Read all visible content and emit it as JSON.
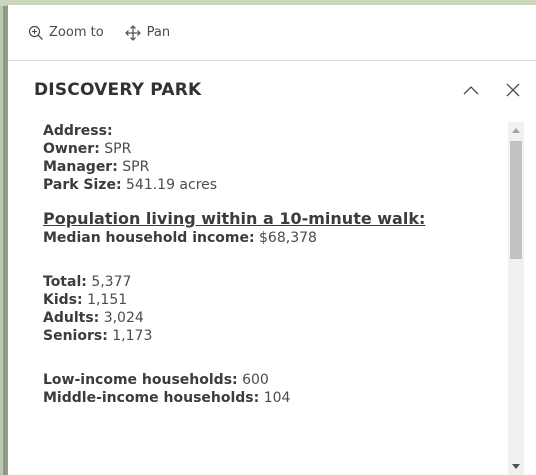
{
  "toolbar": {
    "zoom_label": "Zoom to",
    "pan_label": "Pan"
  },
  "popup": {
    "title": "DISCOVERY PARK"
  },
  "details": {
    "address_label": "Address:",
    "address_value": "",
    "owner_label": "Owner:",
    "owner_value": "SPR",
    "manager_label": "Manager:",
    "manager_value": "SPR",
    "size_label": "Park Size:",
    "size_value": "541.19 acres",
    "population_heading": "Population living within a 10-minute walk:",
    "income_label": "Median household income:",
    "income_value": "$68,378",
    "total_label": "Total:",
    "total_value": "5,377",
    "kids_label": "Kids:",
    "kids_value": "1,151",
    "adults_label": "Adults:",
    "adults_value": "3,024",
    "seniors_label": "Seniors:",
    "seniors_value": "1,173",
    "low_income_label": "Low-income households:",
    "low_income_value": "600",
    "middle_income_label": "Middle-income households:",
    "middle_income_value": "104"
  },
  "colors": {
    "panel_bg": "#ffffff",
    "text": "#4c4c4c",
    "map_bg": "#b9c7ae"
  },
  "icons": {
    "zoom": "zoom-in-icon",
    "pan": "pan-icon",
    "collapse": "chevron-up-icon",
    "close": "close-icon"
  }
}
